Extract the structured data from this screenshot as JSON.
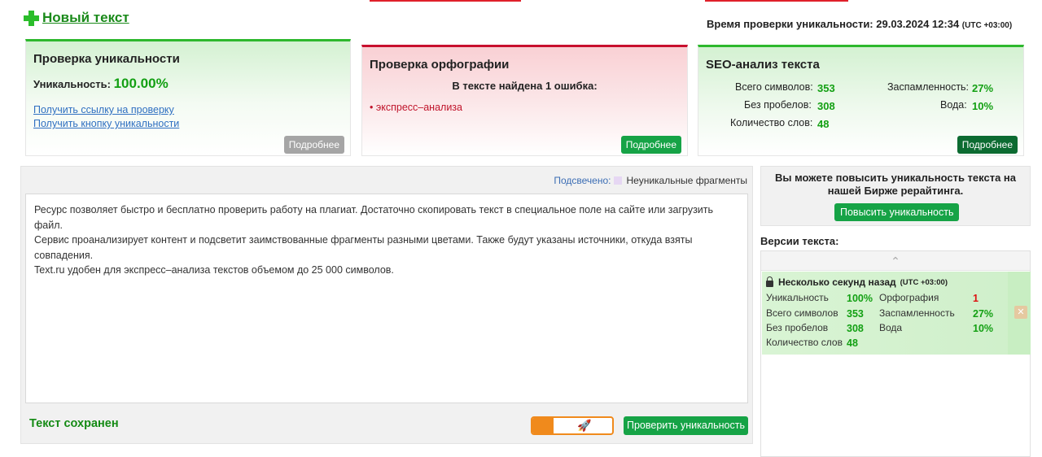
{
  "header": {
    "new_text": "Новый текст",
    "check_time_label": "Время проверки уникальности: 29.03.2024 12:34",
    "check_time_tz": "(UTC +03:00)"
  },
  "uniqueness_card": {
    "title": "Проверка уникальности",
    "uniq_label": "Уникальность:",
    "uniq_value": "100.00%",
    "link_check": "Получить ссылку на проверку",
    "link_button": "Получить кнопку уникальности",
    "more": "Подробнее"
  },
  "spelling_card": {
    "title": "Проверка орфографии",
    "found": "В тексте найдена 1 ошибка:",
    "errors": [
      "экспресс–анализа"
    ],
    "more": "Подробнее"
  },
  "seo_card": {
    "title": "SEO-анализ текста",
    "total_chars_label": "Всего символов:",
    "total_chars": "353",
    "no_spaces_label": "Без пробелов:",
    "no_spaces": "308",
    "words_label": "Количество слов:",
    "words": "48",
    "spam_label": "Заспамленность:",
    "spam": "27%",
    "water_label": "Вода:",
    "water": "10%",
    "more": "Подробнее"
  },
  "editor": {
    "highlight_label": "Подсвечено:",
    "highlight_legend": "Неуникальные фрагменты",
    "text_lines": [
      "Ресурс позволяет быстро и бесплатно проверить работу на плагиат. Достаточно скопировать текст в специальное поле на сайте или загрузить файл.",
      "Сервис проанализирует контент и подсветит заимствованные фрагменты разными цветами. Также будут указаны источники, откуда взяты",
      "совпадения.",
      "Text.ru удобен для экспресс–анализа текстов объемом до 25 000 символов."
    ],
    "saved": "Текст сохранен",
    "check_button": "Проверить уникальность"
  },
  "promo": {
    "text": "Вы можете повысить уникальность текста на нашей Бирже рерайтинга.",
    "button": "Повысить уникальность"
  },
  "versions": {
    "title": "Версии текста:",
    "item": {
      "time": "Несколько секунд назад",
      "tz": "(UTC +03:00)",
      "uniq_label": "Уникальность",
      "uniq": "100%",
      "spelling_label": "Орфография",
      "spelling": "1",
      "total_label": "Всего символов",
      "total": "353",
      "spam_label": "Заспамленность",
      "spam": "27%",
      "nospace_label": "Без пробелов",
      "nospace": "308",
      "water_label": "Вода",
      "water": "10%",
      "words_label": "Количество слов",
      "words": "48"
    }
  },
  "colors": {
    "green": "#16a346",
    "dark_green": "#0c6b31",
    "red": "#c8102e",
    "orange": "#f08a1c"
  }
}
